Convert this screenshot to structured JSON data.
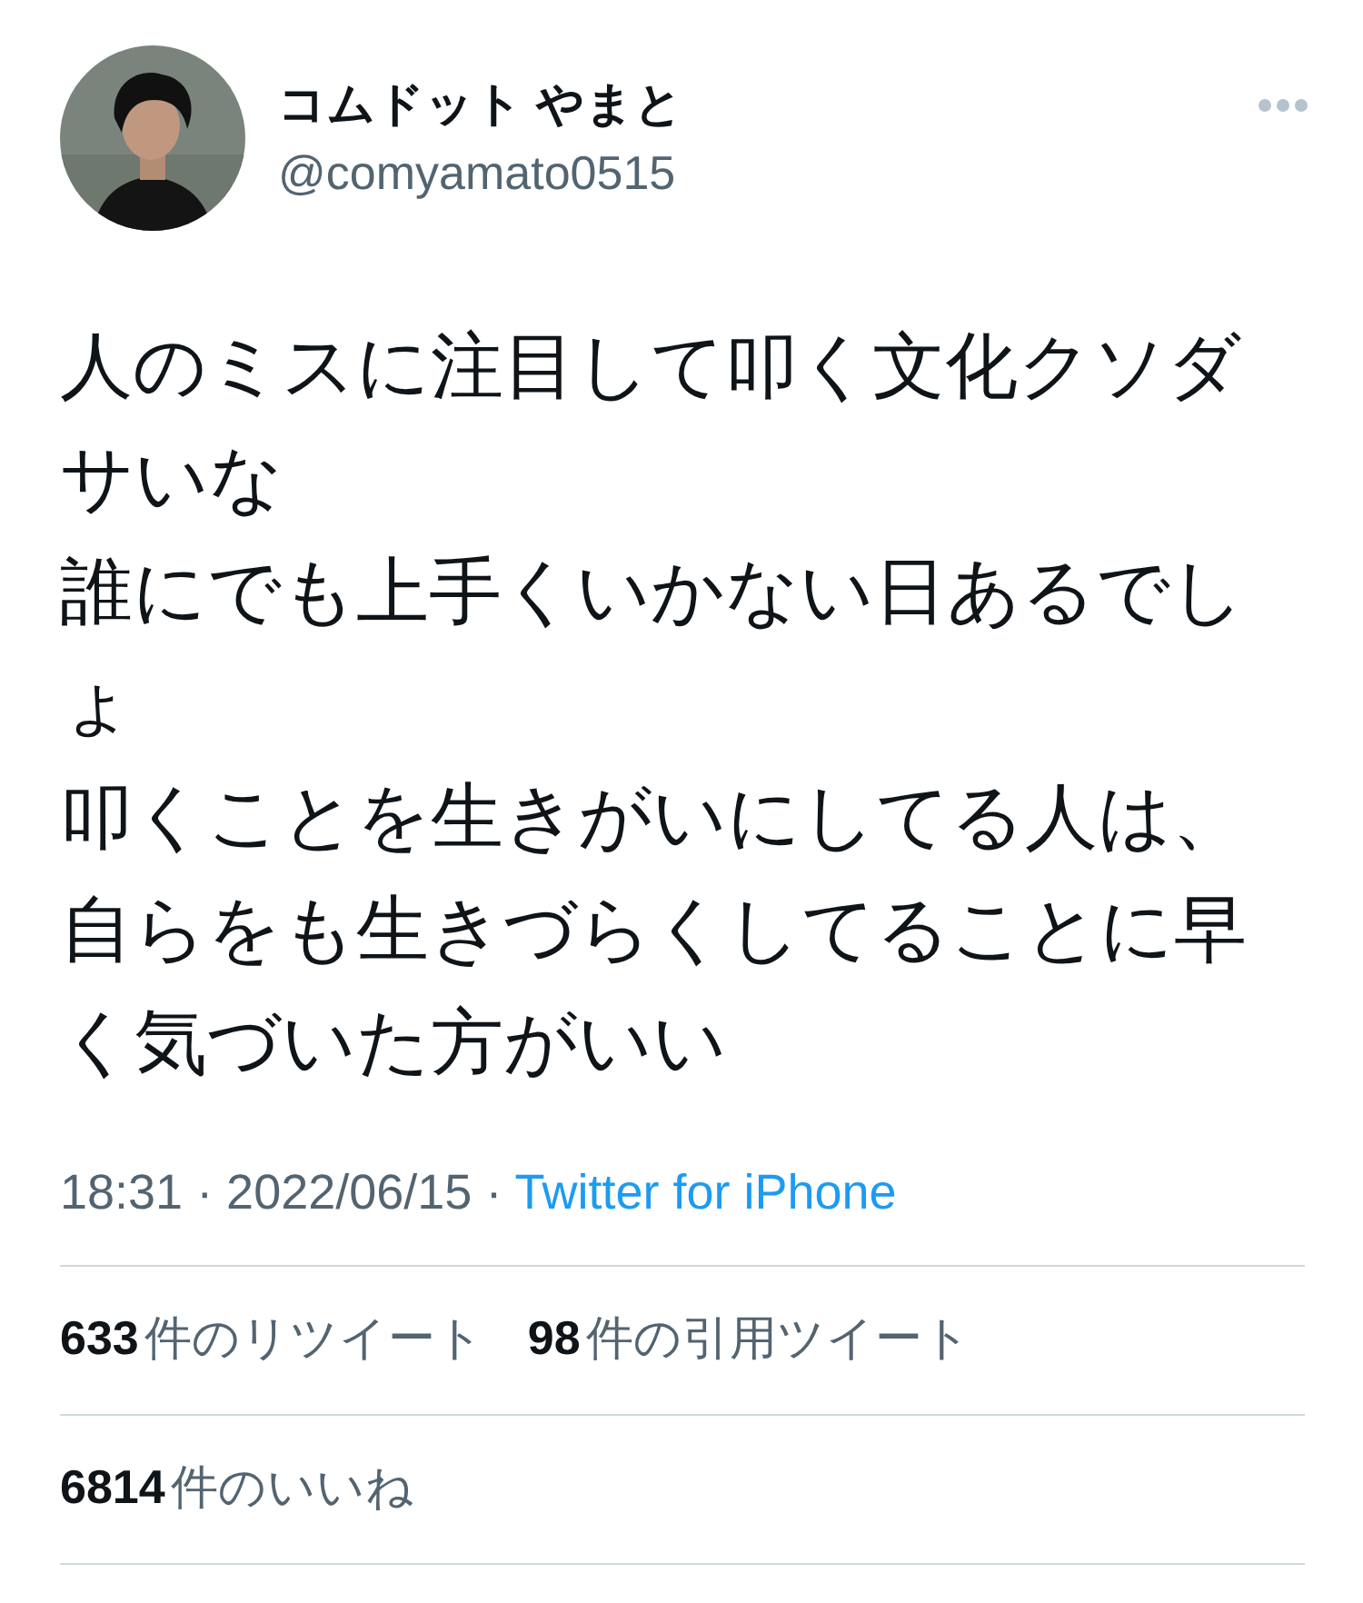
{
  "author": {
    "name": "コムドット やまと",
    "handle": "@comyamato0515"
  },
  "body": [
    "人のミスに注目して叩く文化クソダサいな",
    "誰にでも上手くいかない日あるでしょ",
    "叩くことを生きがいにしてる人は、",
    "自らをも生きづらくしてることに早く気づいた方がいい"
  ],
  "meta": {
    "timestamp": "18:31 · 2022/06/15 ·",
    "source": "Twitter for iPhone"
  },
  "stat_rows": [
    [
      {
        "count": "633",
        "label": "件のリツイート"
      },
      {
        "count": "98",
        "label": "件の引用ツイート"
      }
    ],
    [
      {
        "count": "6814",
        "label": "件のいいね"
      }
    ]
  ]
}
